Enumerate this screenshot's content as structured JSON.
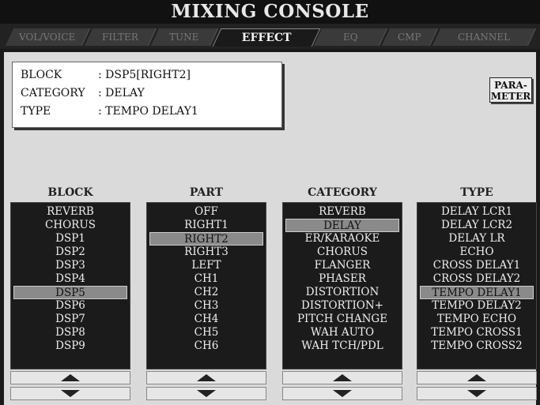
{
  "header": {
    "title": "MIXING CONSOLE"
  },
  "tabs": [
    {
      "label": "VOL/VOICE",
      "active": false
    },
    {
      "label": "FILTER",
      "active": false
    },
    {
      "label": "TUNE",
      "active": false
    },
    {
      "label": "EFFECT",
      "active": true
    },
    {
      "label": "EQ",
      "active": false
    },
    {
      "label": "CMP",
      "active": false
    },
    {
      "label": "CHANNEL",
      "active": false
    }
  ],
  "info": {
    "block_label": "BLOCK",
    "block_value": ": DSP5[RIGHT2]",
    "category_label": "CATEGORY",
    "category_value": ": DELAY",
    "type_label": "TYPE",
    "type_value": ": TEMPO DELAY1"
  },
  "parameter_button": {
    "line1": "PARA-",
    "line2": "METER"
  },
  "columns": {
    "block": {
      "header": "BLOCK",
      "items": [
        "REVERB",
        "CHORUS",
        "DSP1",
        "DSP2",
        "DSP3",
        "DSP4",
        "DSP5",
        "DSP6",
        "DSP7",
        "DSP8",
        "DSP9"
      ],
      "selected": 6
    },
    "part": {
      "header": "PART",
      "items": [
        "OFF",
        "RIGHT1",
        "RIGHT2",
        "RIGHT3",
        "LEFT",
        "CH1",
        "CH2",
        "CH3",
        "CH4",
        "CH5",
        "CH6"
      ],
      "selected": 2
    },
    "category": {
      "header": "CATEGORY",
      "items": [
        "REVERB",
        "DELAY",
        "ER/KARAOKE",
        "CHORUS",
        "FLANGER",
        "PHASER",
        "DISTORTION",
        "DISTORTION+",
        "PITCH CHANGE",
        "WAH AUTO",
        "WAH TCH/PDL"
      ],
      "selected": 1
    },
    "type": {
      "header": "TYPE",
      "items": [
        "DELAY LCR1",
        "DELAY LCR2",
        "DELAY LR",
        "ECHO",
        "CROSS DELAY1",
        "CROSS DELAY2",
        "TEMPO DELAY1",
        "TEMPO DELAY2",
        "TEMPO ECHO",
        "TEMPO CROSS1",
        "TEMPO CROSS2"
      ],
      "selected": 6
    }
  },
  "icons": {
    "scroll_up": "triangle-up-icon",
    "scroll_down": "triangle-down-icon"
  }
}
